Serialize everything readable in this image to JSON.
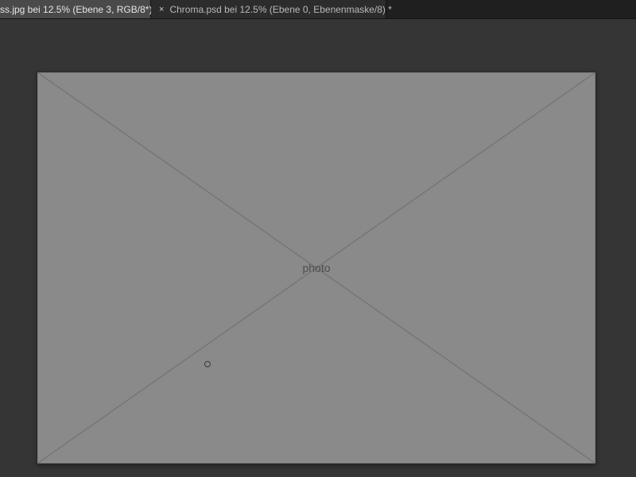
{
  "tabs": [
    {
      "title": "ss.jpg bei 12.5% (Ebene 3, RGB/8*) *",
      "active": true
    },
    {
      "close_glyph": "×",
      "title": "Chroma.psd bei 12.5% (Ebene 0, Ebenenmaske/8) *",
      "active": false
    }
  ],
  "canvas": {
    "placeholder_label": "photo"
  },
  "cursor": {
    "icon": "brush-circle-icon"
  },
  "colors": {
    "workspace_bg": "#353535",
    "tabbar_bg": "#1f1f1f",
    "active_tab_bg": "#4a4a4a",
    "inactive_tab_bg": "#2c2c2c"
  }
}
